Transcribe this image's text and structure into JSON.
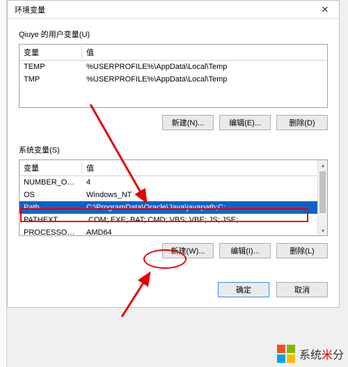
{
  "window": {
    "title": "环境变量"
  },
  "user_section": {
    "label": "Qiuye 的用户变量(U)",
    "columns": {
      "name": "变量",
      "value": "值"
    },
    "rows": [
      {
        "name": "TEMP",
        "value": "%USERPROFILE%\\AppData\\Local\\Temp"
      },
      {
        "name": "TMP",
        "value": "%USERPROFILE%\\AppData\\Local\\Temp"
      }
    ],
    "buttons": {
      "new": "新建(N)...",
      "edit": "编辑(E)...",
      "delete": "删除(D)"
    }
  },
  "system_section": {
    "label": "系统变量(S)",
    "columns": {
      "name": "变量",
      "value": "值"
    },
    "rows": [
      {
        "name": "NUMBER_OF_PR...",
        "value": "4"
      },
      {
        "name": "OS",
        "value": "Windows_NT"
      },
      {
        "name": "Path",
        "value": "C:\\ProgramData\\Oracle\\Java\\javapath;C:..."
      },
      {
        "name": "PATHEXT",
        "value": ".COM;.EXE;.BAT;.CMD;.VBS;.VBE;.JS;.JSE;..."
      },
      {
        "name": "PROCESSOR_AR...",
        "value": "AMD64"
      }
    ],
    "selected_index": 2,
    "buttons": {
      "new": "新建(W)...",
      "edit": "编辑(I)...",
      "delete": "删除(L)"
    }
  },
  "dialog_buttons": {
    "ok": "确定",
    "cancel": "取消"
  },
  "watermark": {
    "prefix": "系统",
    "dot": "米",
    "suffix": "分"
  },
  "annotation_color": "#e60000"
}
